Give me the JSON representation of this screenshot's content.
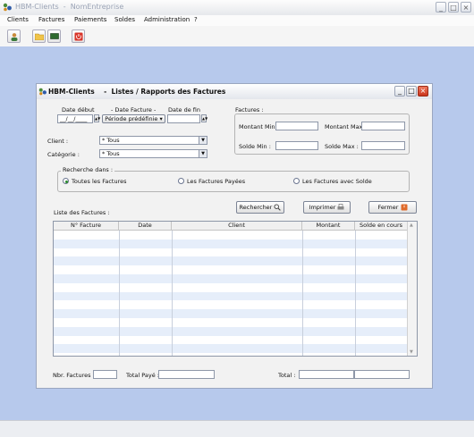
{
  "app": {
    "title": "HBM-Clients",
    "subtitle": "NomEntreprise",
    "menu": [
      "Clients",
      "Factures",
      "Paiements",
      "Soldes",
      "Administration",
      "?"
    ]
  },
  "dialog": {
    "title": "HBM-Clients    -  Listes / Rapports des Factures",
    "date_debut_label": "Date début",
    "date_facture_label": "- Date  Facture -",
    "date_fin_label": "Date de fin",
    "date_debut_value": "__/__/____",
    "periode_button": "Période prédéfinie",
    "factures_label": "Factures :",
    "montant_min_label": "Montant Min :",
    "montant_max_label": "Montant Max :",
    "solde_min_label": "Solde Min :",
    "solde_max_label": "Solde Max :",
    "client_label": "Client :",
    "client_value": "* Tous",
    "categorie_label": "Catégorie :",
    "categorie_value": "* Tous",
    "recherche_label": "Recherche dans :",
    "radio_toutes": "Toutes les Factures",
    "radio_payees": "Les Factures Payées",
    "radio_solde": "Les Factures avec Solde",
    "liste_label": "Liste des Factures  :",
    "rechercher_button": "Rechercher",
    "imprimer_button": "Imprimer",
    "fermer_button": "Fermer",
    "columns": [
      "N° Facture",
      "Date",
      "Client",
      "Montant",
      "Solde en cours"
    ],
    "nbr_factures_label": "Nbr. Factures :",
    "total_paye_label": "Total Payé :",
    "total_label": "Total :"
  }
}
